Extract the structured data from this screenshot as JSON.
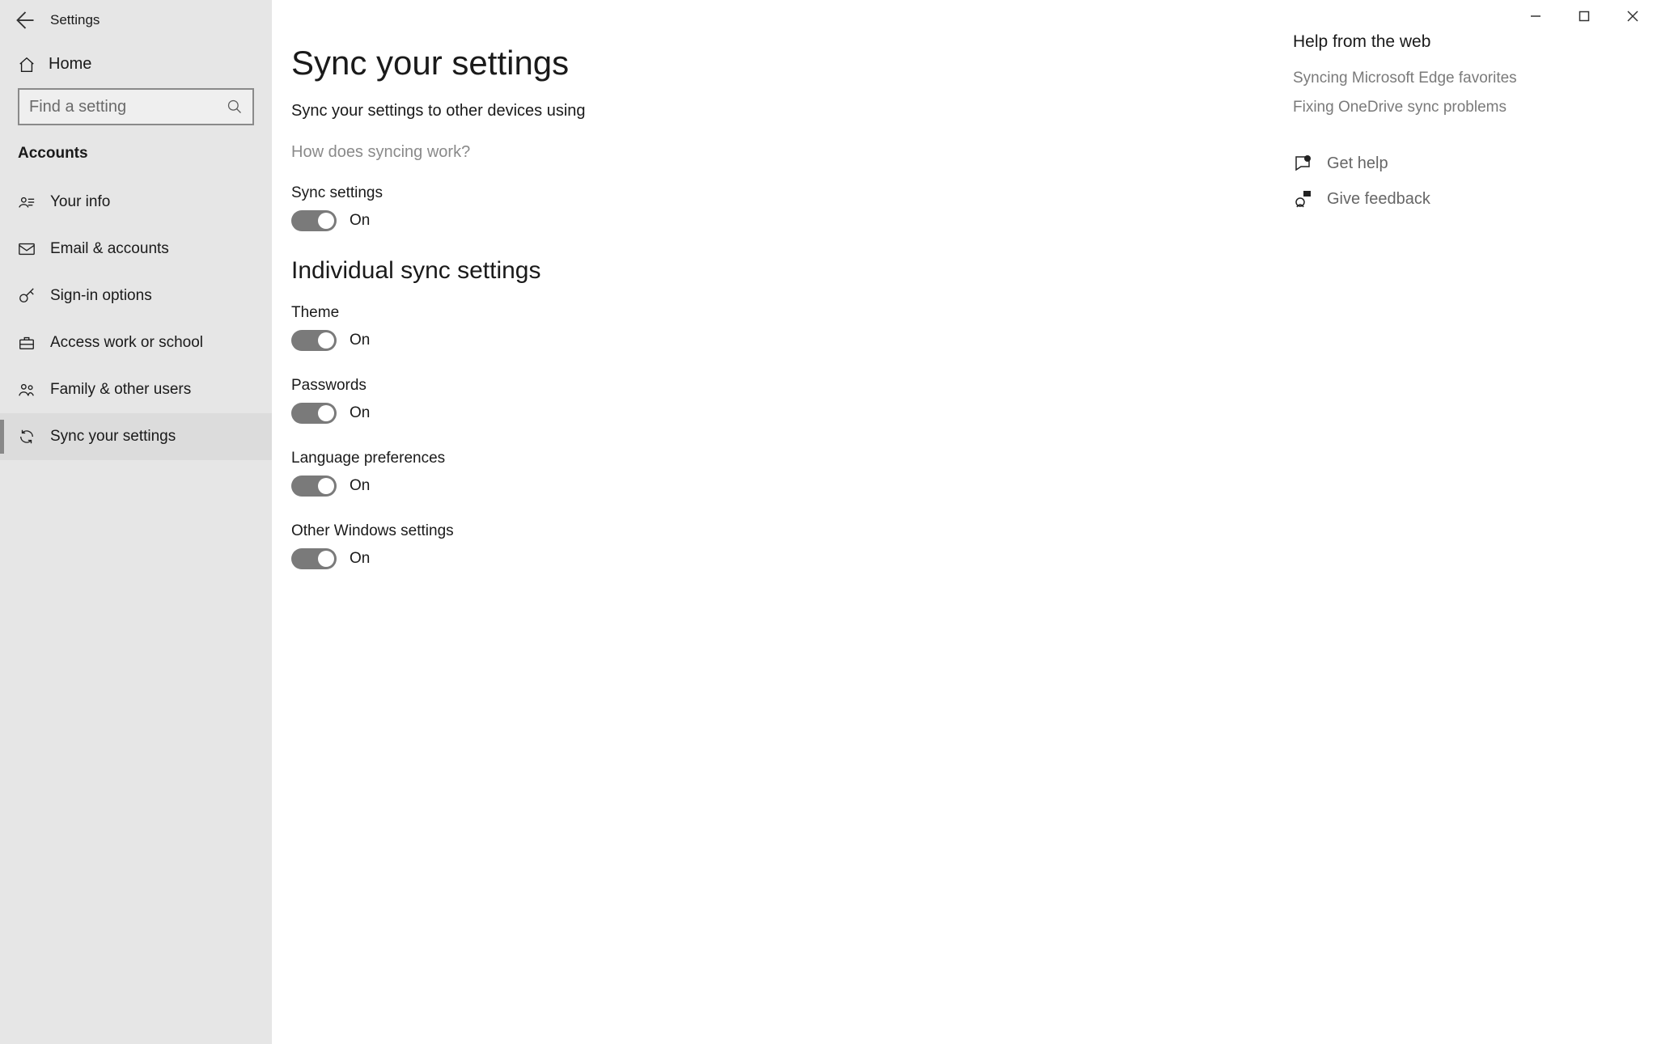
{
  "window": {
    "title": "Settings"
  },
  "sidebar": {
    "home_label": "Home",
    "search_placeholder": "Find a setting",
    "section_label": "Accounts",
    "items": [
      {
        "label": "Your info"
      },
      {
        "label": "Email & accounts"
      },
      {
        "label": "Sign-in options"
      },
      {
        "label": "Access work or school"
      },
      {
        "label": "Family & other users"
      },
      {
        "label": "Sync your settings"
      }
    ],
    "active_index": 5
  },
  "main": {
    "title": "Sync your settings",
    "intro": "Sync your settings to other devices using",
    "how_link": "How does syncing work?",
    "sync_settings": {
      "label": "Sync settings",
      "state": "On"
    },
    "individual_title": "Individual sync settings",
    "individual": [
      {
        "label": "Theme",
        "state": "On"
      },
      {
        "label": "Passwords",
        "state": "On"
      },
      {
        "label": "Language preferences",
        "state": "On"
      },
      {
        "label": "Other Windows settings",
        "state": "On"
      }
    ]
  },
  "right": {
    "help_title": "Help from the web",
    "links": [
      "Syncing Microsoft Edge favorites",
      "Fixing OneDrive sync problems"
    ],
    "get_help": "Get help",
    "give_feedback": "Give feedback"
  }
}
